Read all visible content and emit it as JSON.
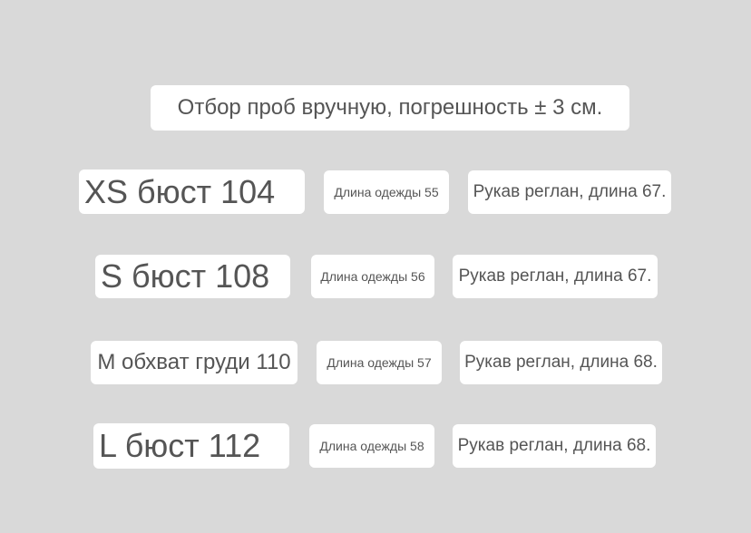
{
  "note": "Отбор проб вручную, погрешность ± 3 см.",
  "rows": [
    {
      "size": "XS бюст 104",
      "length": "Длина одежды 55",
      "sleeve": "Рукав реглан, длина 67."
    },
    {
      "size": "S бюст 108",
      "length": "Длина одежды 56",
      "sleeve": "Рукав реглан, длина 67."
    },
    {
      "size": "M обхват груди 110",
      "length": "Длина одежды 57",
      "sleeve": "Рукав реглан, длина 68."
    },
    {
      "size": "L бюст 112",
      "length": "Длина одежды 58",
      "sleeve": "Рукав реглан, длина 68."
    }
  ]
}
